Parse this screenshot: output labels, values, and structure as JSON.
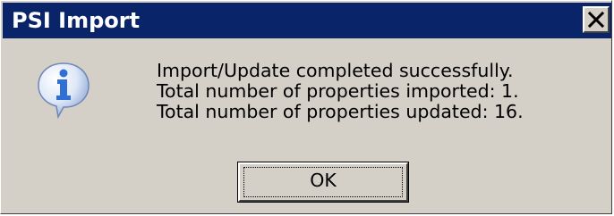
{
  "window": {
    "title": "PSI Import",
    "close_icon": "close-icon"
  },
  "message": {
    "icon": "info-icon",
    "lines": [
      "Import/Update completed successfully.",
      "Total number of properties imported: 1.",
      "Total number of properties updated: 16."
    ]
  },
  "buttons": {
    "ok_label": "OK"
  },
  "colors": {
    "title_bar": "#0a246a",
    "dialog_bg": "#d4d0c8",
    "title_text": "#ffffff",
    "icon_blue": "#2f6fd6"
  }
}
